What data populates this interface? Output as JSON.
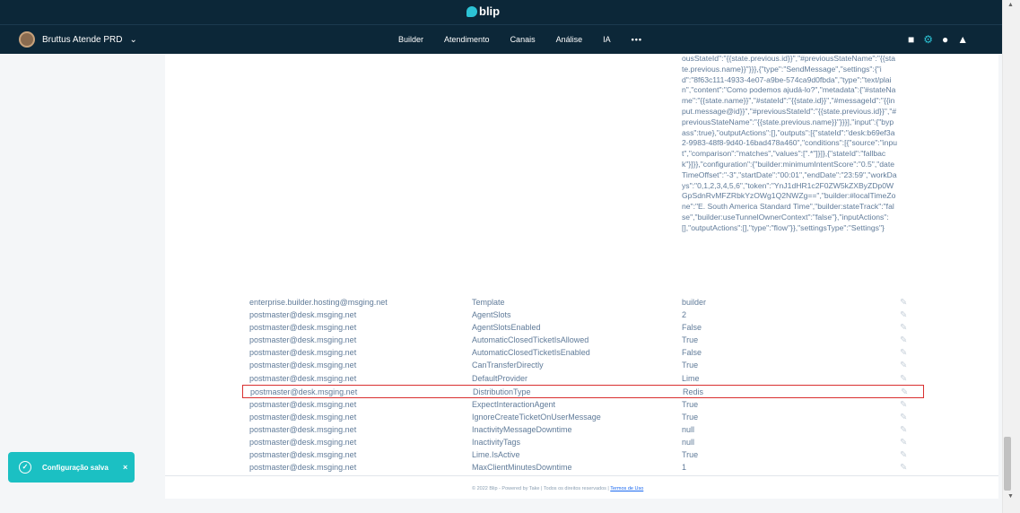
{
  "brand": {
    "name": "blip"
  },
  "navbar": {
    "bot_name": "Bruttus Atende PRD",
    "links": [
      "Builder",
      "Atendimento",
      "Canais",
      "Análise",
      "IA"
    ],
    "more": "•••",
    "icons": [
      "puzzle-icon",
      "gear-icon",
      "team-icon",
      "flask-icon"
    ]
  },
  "json_value": "ousStateId\":\"{{state.previous.id}}\",\"#previousStateName\":\"{{state.previous.name}}\"}}},{\"type\":\"SendMessage\",\"settings\":{\"id\":\"8f63c111-4933-4e07-a9be-574ca9d0fbda\",\"type\":\"text/plain\",\"content\":\"Como podemos ajudá-lo?\",\"metadata\":{\"#stateName\":\"{{state.name}}\",\"#stateId\":\"{{state.id}}\",\"#messageId\":\"{{input.message@id}}\",\"#previousStateId\":\"{{state.previous.id}}\",\"#previousStateName\":\"{{state.previous.name}}\"}}}],\"input\":{\"bypass\":true},\"outputActions\":[],\"outputs\":[{\"stateId\":\"desk:b69ef3a2-9983-48f8-9d40-16bad478a460\",\"conditions\":[{\"source\":\"input\",\"comparison\":\"matches\",\"values\":[\".*\"]}]},{\"stateId\":\"fallback\"}]}},\"configuration\":{\"builder:minimumIntentScore\":\"0.5\",\"dateTimeOffset\":\"-3\",\"startDate\":\"00:01\",\"endDate\":\"23:59\",\"workDays\":\"0,1,2,3,4,5,6\",\"token\":\"YnJ1dHR1c2F0ZW5kZXByZDp0WGpSdnRvMFZRbkYzOWg1Q2NWZg==\",\"builder:#localTimeZone\":\"E. South America Standard Time\",\"builder:stateTrack\":\"false\",\"builder:useTunnelOwnerContext\":\"false\"},\"inputActions\":[],\"outputActions\":[],\"type\":\"flow\"}},\"settingsType\":\"Settings\"}",
  "rows": [
    {
      "owner": "enterprise.builder.hosting@msging.net",
      "key": "Template",
      "value": "builder"
    },
    {
      "owner": "postmaster@desk.msging.net",
      "key": "AgentSlots",
      "value": "2"
    },
    {
      "owner": "postmaster@desk.msging.net",
      "key": "AgentSlotsEnabled",
      "value": "False"
    },
    {
      "owner": "postmaster@desk.msging.net",
      "key": "AutomaticClosedTicketIsAllowed",
      "value": "True"
    },
    {
      "owner": "postmaster@desk.msging.net",
      "key": "AutomaticClosedTicketIsEnabled",
      "value": "False"
    },
    {
      "owner": "postmaster@desk.msging.net",
      "key": "CanTransferDirectly",
      "value": "True"
    },
    {
      "owner": "postmaster@desk.msging.net",
      "key": "DefaultProvider",
      "value": "Lime"
    },
    {
      "owner": "postmaster@desk.msging.net",
      "key": "DistributionType",
      "value": "Redis"
    },
    {
      "owner": "postmaster@desk.msging.net",
      "key": "ExpectInteractionAgent",
      "value": "True"
    },
    {
      "owner": "postmaster@desk.msging.net",
      "key": "IgnoreCreateTicketOnUserMessage",
      "value": "True"
    },
    {
      "owner": "postmaster@desk.msging.net",
      "key": "InactivityMessageDowntime",
      "value": "null"
    },
    {
      "owner": "postmaster@desk.msging.net",
      "key": "InactivityTags",
      "value": "null"
    },
    {
      "owner": "postmaster@desk.msging.net",
      "key": "Lime.IsActive",
      "value": "True"
    },
    {
      "owner": "postmaster@desk.msging.net",
      "key": "MaxClientMinutesDowntime",
      "value": "1"
    }
  ],
  "highlighted_row": 7,
  "footer": {
    "text": "© 2022 Blip - Powered by Take | Todos os direitos reservados | ",
    "link": "Termos de Uso"
  },
  "toast": {
    "text": "Configuração salva",
    "close": "×"
  },
  "colors": {
    "navbar": "#0c2738",
    "accent": "#2cc3d5",
    "toast": "#1bc0c3",
    "highlight": "#d93030"
  }
}
